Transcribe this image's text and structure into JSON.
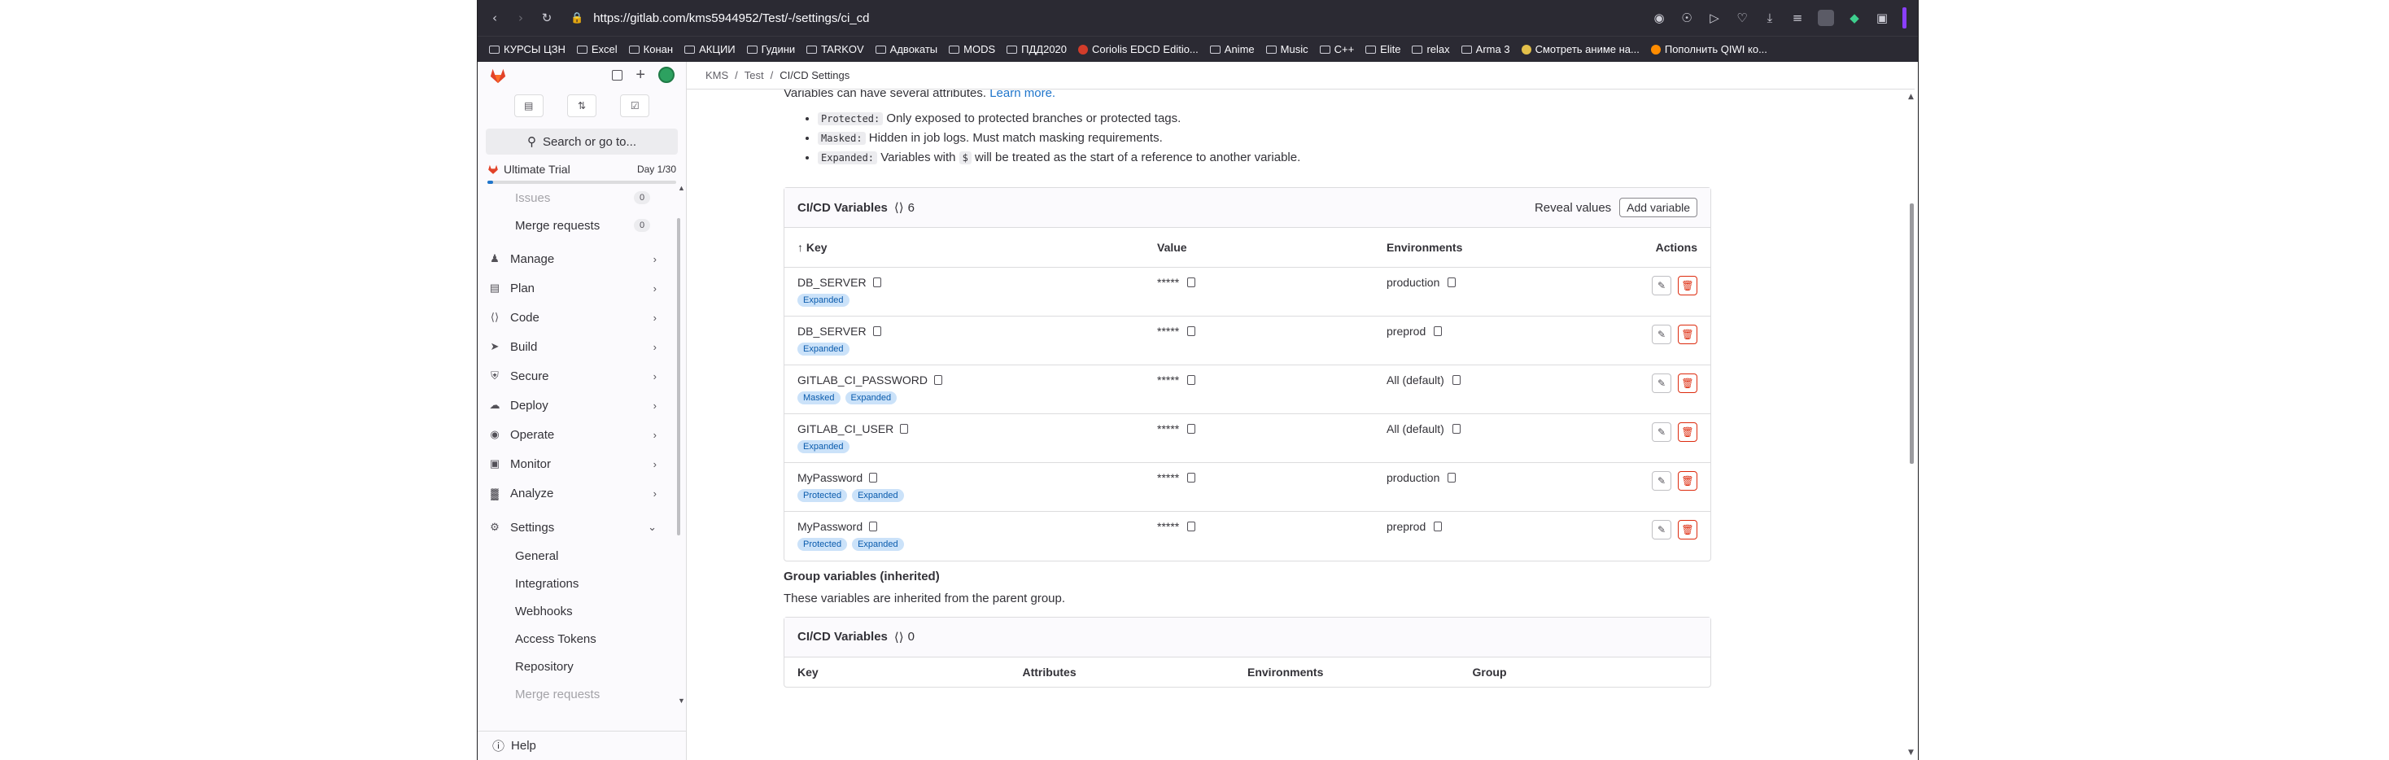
{
  "browser": {
    "url": "https://gitlab.com/kms5944952/Test/-/settings/ci_cd",
    "bookmarks": [
      "КУРСЫ ЦЗН",
      "Excel",
      "Конан",
      "АКЦИИ",
      "Гудини",
      "TARKOV",
      "Адвокаты",
      "MODS",
      "ПДД2020",
      "Coriolis EDCD Editio...",
      "Anime",
      "Music",
      "C++",
      "Elite",
      "relax",
      "Arma 3",
      "Смотреть аниме на...",
      "Пополнить QIWI ко..."
    ]
  },
  "breadcrumb": [
    "KMS",
    "Test",
    "CI/CD Settings"
  ],
  "sidebar": {
    "search_label": "Search or go to...",
    "trial": {
      "label": "Ultimate Trial",
      "day": "Day 1/30",
      "progress_percent": 3
    },
    "sub_items_top": [
      {
        "label": "Issues",
        "count": "0"
      },
      {
        "label": "Merge requests",
        "count": "0"
      }
    ],
    "nav": [
      {
        "label": "Manage",
        "icon": "users-icon"
      },
      {
        "label": "Plan",
        "icon": "plan-icon"
      },
      {
        "label": "Code",
        "icon": "code-icon"
      },
      {
        "label": "Build",
        "icon": "rocket-icon"
      },
      {
        "label": "Secure",
        "icon": "shield-icon"
      },
      {
        "label": "Deploy",
        "icon": "deploy-icon"
      },
      {
        "label": "Operate",
        "icon": "cloud-icon"
      },
      {
        "label": "Monitor",
        "icon": "monitor-icon"
      },
      {
        "label": "Analyze",
        "icon": "chart-icon"
      }
    ],
    "settings": {
      "label": "Settings",
      "items": [
        "General",
        "Integrations",
        "Webhooks",
        "Access Tokens",
        "Repository",
        "Merge requests"
      ]
    },
    "help_label": "Help"
  },
  "main": {
    "intro": "Variables can have several attributes.",
    "learn_more": "Learn more.",
    "attrs": [
      {
        "code": "Protected:",
        "text": "Only exposed to protected branches or protected tags."
      },
      {
        "code": "Masked:",
        "text": "Hidden in job logs. Must match masking requirements."
      },
      {
        "code": "Expanded:",
        "pre": "Variables with",
        "code2": "$",
        "text": "will be treated as the start of a reference to another variable."
      }
    ],
    "variables_card": {
      "title": "CI/CD Variables",
      "count": "6",
      "reveal_label": "Reveal values",
      "add_label": "Add variable",
      "columns": {
        "key": "Key",
        "value": "Value",
        "environments": "Environments",
        "actions": "Actions"
      },
      "rows": [
        {
          "key": "DB_SERVER",
          "badges": [
            "Expanded"
          ],
          "value": "*****",
          "env": "production"
        },
        {
          "key": "DB_SERVER",
          "badges": [
            "Expanded"
          ],
          "value": "*****",
          "env": "preprod"
        },
        {
          "key": "GITLAB_CI_PASSWORD",
          "badges": [
            "Masked",
            "Expanded"
          ],
          "value": "*****",
          "env": "All (default)"
        },
        {
          "key": "GITLAB_CI_USER",
          "badges": [
            "Expanded"
          ],
          "value": "*****",
          "env": "All (default)"
        },
        {
          "key": "MyPassword",
          "badges": [
            "Protected",
            "Expanded"
          ],
          "value": "*****",
          "env": "production"
        },
        {
          "key": "MyPassword",
          "badges": [
            "Protected",
            "Expanded"
          ],
          "value": "*****",
          "env": "preprod"
        }
      ]
    },
    "group_section": {
      "title": "Group variables (inherited)",
      "desc": "These variables are inherited from the parent group.",
      "card_title": "CI/CD Variables",
      "count": "0",
      "columns": [
        "Key",
        "Attributes",
        "Environments",
        "Group"
      ]
    }
  }
}
